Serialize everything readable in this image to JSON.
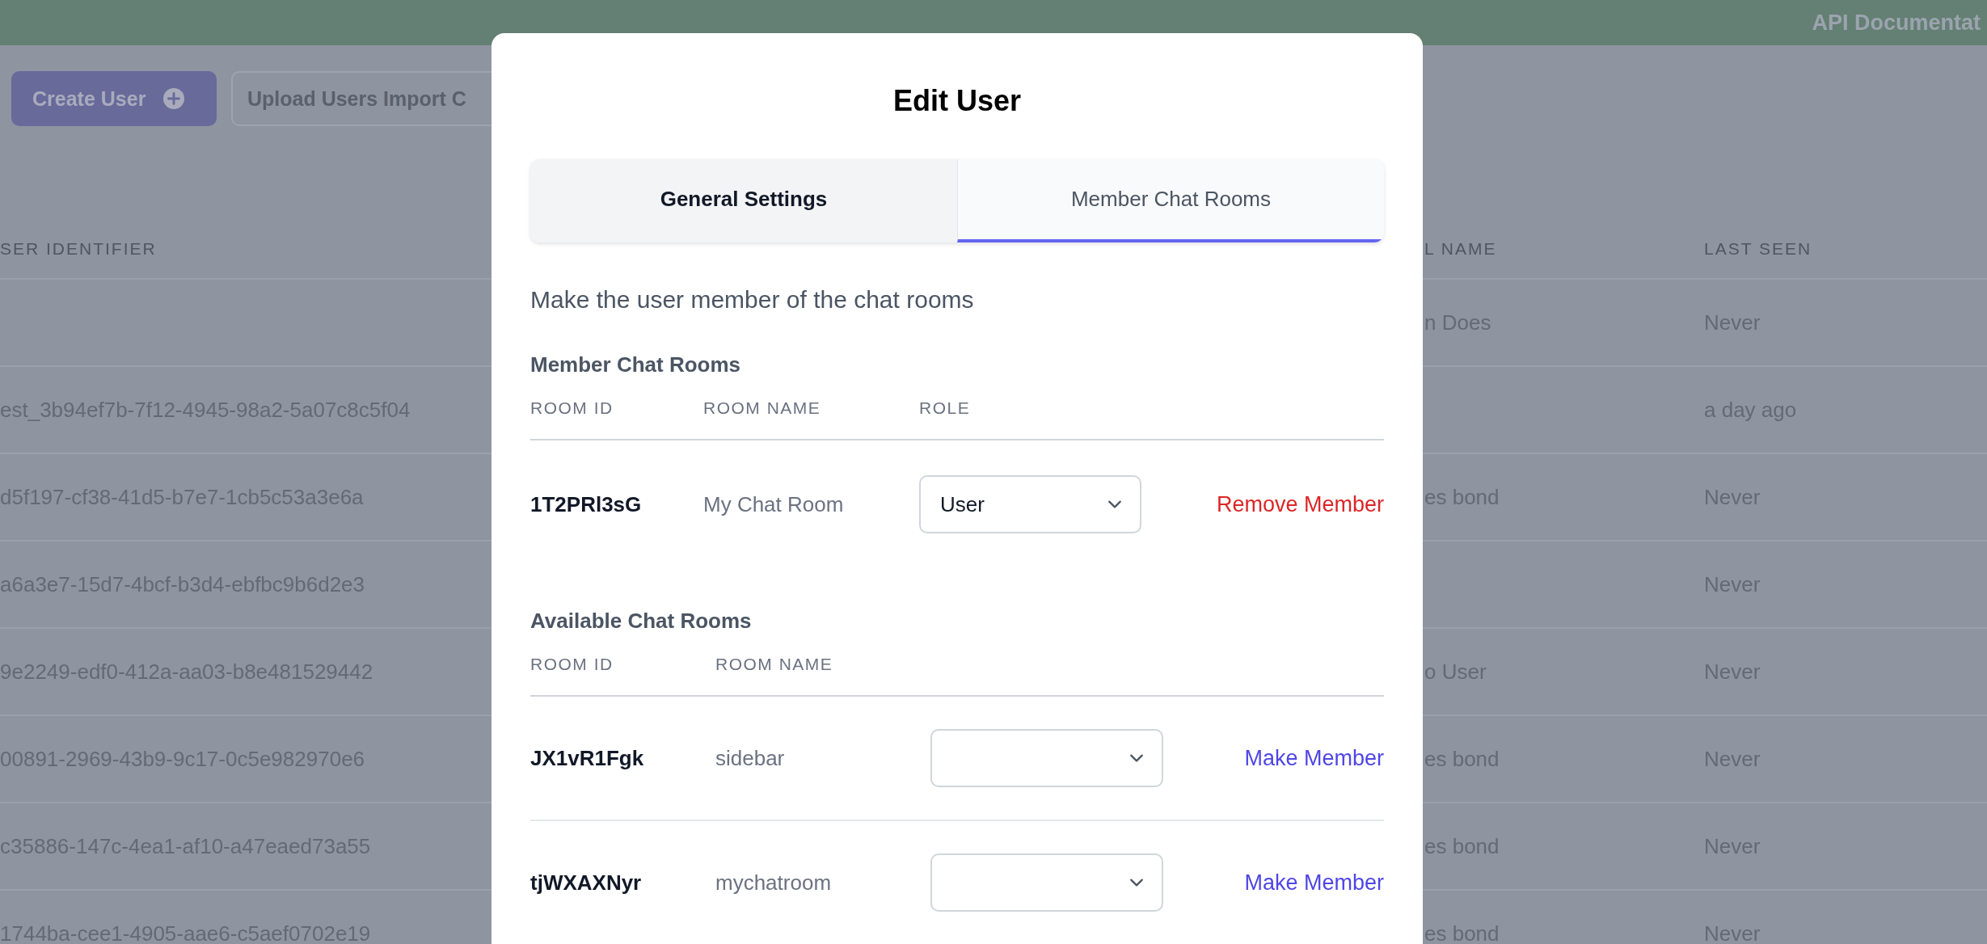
{
  "top_bar": {
    "link": "API Documentat"
  },
  "toolbar": {
    "buttons": [
      {
        "label": "Create User",
        "kind": "primary"
      },
      {
        "label": "Upload Users Import C",
        "kind": "secondary"
      }
    ]
  },
  "users_table": {
    "columns": [
      "SER IDENTIFIER",
      "L NAME",
      "LAST SEEN"
    ],
    "rows": [
      {
        "name": "n Does",
        "last_seen": "Never"
      },
      {
        "identifier": "est_3b94ef7b-7f12-4945-98a2-5a07c8c5f04",
        "last_seen": "a day ago"
      },
      {
        "identifier": "d5f197-cf38-41d5-b7e7-1cb5c53a3e6a",
        "name": "es bond",
        "last_seen": "Never"
      },
      {
        "identifier": "a6a3e7-15d7-4bcf-b3d4-ebfbc9b6d2e3",
        "last_seen": "Never"
      },
      {
        "identifier": "9e2249-edf0-412a-aa03-b8e481529442",
        "name": "o User",
        "last_seen": "Never"
      },
      {
        "identifier": "00891-2969-43b9-9c17-0c5e982970e6",
        "name": "es bond",
        "last_seen": "Never"
      },
      {
        "identifier": "c35886-147c-4ea1-af10-a47eaed73a55",
        "name": "es bond",
        "last_seen": "Never"
      },
      {
        "identifier": "1744ba-cee1-4905-aae6-c5aef0702e19",
        "name": "es bond",
        "last_seen": "Never"
      }
    ]
  },
  "modal": {
    "title": "Edit User",
    "tabs": [
      {
        "label": "General Settings",
        "selected": false
      },
      {
        "label": "Member Chat Rooms",
        "selected": true
      }
    ],
    "description": "Make the user member of the chat rooms",
    "member_rooms": {
      "heading": "Member Chat Rooms",
      "columns": [
        "ROOM ID",
        "ROOM NAME",
        "ROLE"
      ],
      "rows": [
        {
          "room_id": "1T2PRl3sG",
          "room_name": "My Chat Room",
          "role": "User",
          "action": "Remove Member"
        }
      ]
    },
    "available_rooms": {
      "heading": "Available Chat Rooms",
      "columns": [
        "ROOM ID",
        "ROOM NAME"
      ],
      "rows": [
        {
          "room_id": "JX1vR1Fgk",
          "room_name": "sidebar",
          "action": "Make Member"
        },
        {
          "room_id": "tjWXAXNyr",
          "room_name": "mychatroom",
          "action": "Make Member"
        }
      ]
    }
  }
}
